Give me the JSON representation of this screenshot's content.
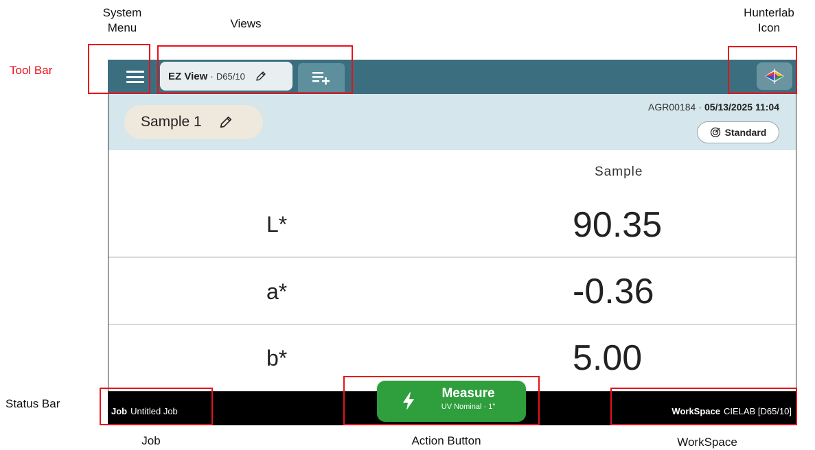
{
  "annotations": {
    "system_menu": [
      "System",
      "Menu"
    ],
    "views": "Views",
    "hunterlab_icon": [
      "Hunterlab",
      "Icon"
    ],
    "tool_bar": "Tool Bar",
    "status_bar": "Status Bar",
    "job": "Job",
    "action_button": "Action Button",
    "workspace": "WorkSpace"
  },
  "toolbar": {
    "view_name": "EZ View",
    "view_separator": "·",
    "view_illuminant": "D65/10"
  },
  "sample": {
    "name": "Sample 1",
    "instrument_id": "AGR00184",
    "separator": "·",
    "datetime": "05/13/2025 11:04",
    "standard_label": "Standard"
  },
  "table": {
    "column_header": "Sample",
    "rows": [
      {
        "label": "L*",
        "value": "90.35"
      },
      {
        "label": "a*",
        "value": "-0.36"
      },
      {
        "label": "b*",
        "value": "5.00"
      }
    ]
  },
  "statusbar": {
    "job_label": "Job",
    "job_value": "Untitled Job",
    "workspace_label": "WorkSpace",
    "workspace_value": "CIELAB [D65/10]"
  },
  "action": {
    "title": "Measure",
    "subtitle": "UV Nominal · 1\""
  },
  "colors": {
    "toolbar": "#3b6f80",
    "sample_band": "#d5e6ec",
    "measure_button": "#2f9e3c",
    "annotation_box": "#e8111b"
  }
}
